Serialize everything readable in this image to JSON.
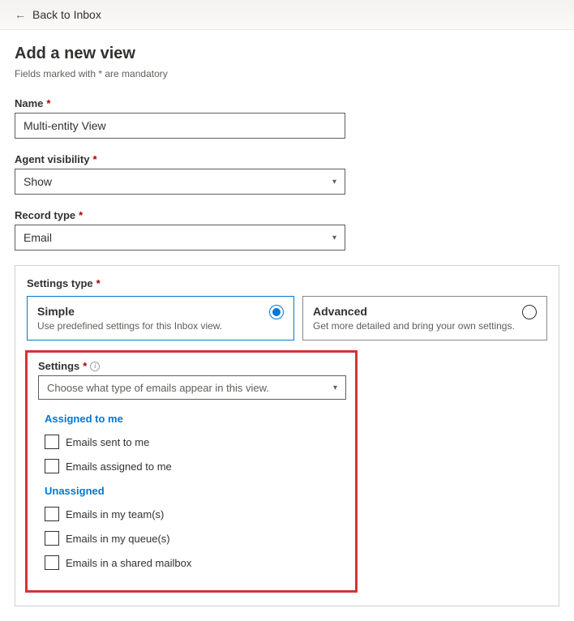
{
  "topbar": {
    "back_label": "Back to Inbox"
  },
  "page": {
    "title": "Add a new view",
    "subtitle": "Fields marked with * are mandatory"
  },
  "fields": {
    "name": {
      "label": "Name",
      "value": "Multi-entity View"
    },
    "agent_visibility": {
      "label": "Agent visibility",
      "value": "Show"
    },
    "record_type": {
      "label": "Record type",
      "value": "Email"
    },
    "settings_type": {
      "label": "Settings type"
    },
    "settings": {
      "label": "Settings",
      "placeholder": "Choose what type of emails appear in this view."
    }
  },
  "settings_type_options": {
    "simple": {
      "title": "Simple",
      "desc": "Use predefined settings for this Inbox view."
    },
    "advanced": {
      "title": "Advanced",
      "desc": "Get more detailed and bring your own settings."
    }
  },
  "settings_groups": {
    "assigned": {
      "header": "Assigned to me",
      "items": [
        "Emails sent to me",
        "Emails assigned to me"
      ]
    },
    "unassigned": {
      "header": "Unassigned",
      "items": [
        "Emails in my team(s)",
        "Emails in my queue(s)",
        "Emails in a shared mailbox"
      ]
    }
  }
}
